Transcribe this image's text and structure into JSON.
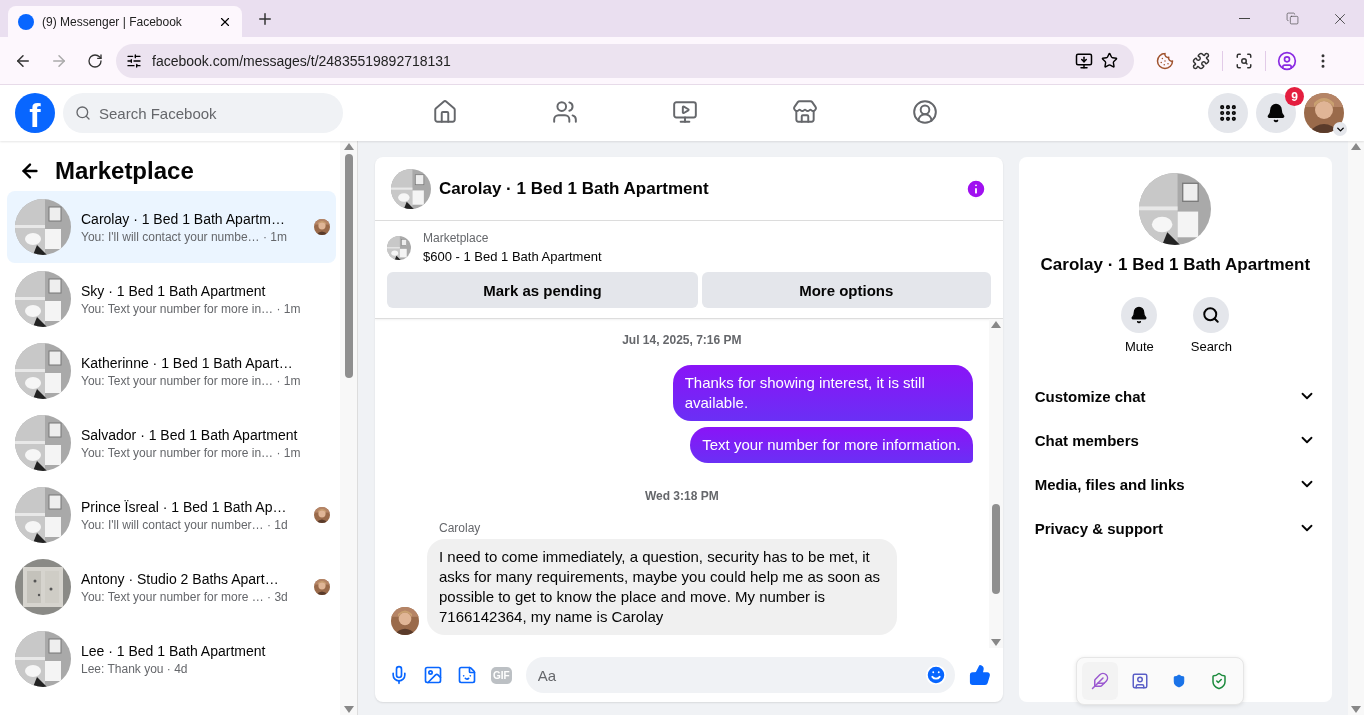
{
  "browser": {
    "tab": {
      "title": "(9) Messenger | Facebook"
    },
    "url": "facebook.com/messages/t/24835519892718131"
  },
  "topbar": {
    "logo": "f",
    "search": {
      "placeholder": "Search Facebook"
    },
    "nav": [
      {
        "kind": "home",
        "selected": false
      },
      {
        "kind": "friends",
        "selected": false
      },
      {
        "kind": "video",
        "selected": false
      },
      {
        "kind": "marketplace",
        "selected": false
      },
      {
        "kind": "groups",
        "selected": false
      }
    ],
    "notifications_badge": "9"
  },
  "sidebar": {
    "title": "Marketplace",
    "conversations": [
      {
        "name": "Carolay · 1 Bed 1 Bath Apartm…",
        "preview": "You: I'll will contact your numbe…",
        "time": "· 1m",
        "selected": true,
        "seen": true
      },
      {
        "name": "Sky · 1 Bed 1 Bath Apartment",
        "preview": "You: Text your number for more in…",
        "time": "· 1m",
        "selected": false,
        "seen": false
      },
      {
        "name": "Katherinne · 1 Bed 1 Bath Apart…",
        "preview": "You: Text your number for more in…",
        "time": "· 1m",
        "selected": false,
        "seen": false
      },
      {
        "name": "Salvador · 1 Bed 1 Bath Apartment",
        "preview": "You: Text your number for more in…",
        "time": "· 1m",
        "selected": false,
        "seen": false
      },
      {
        "name": "Prince Ïsreal · 1 Bed 1 Bath Ap…",
        "preview": "You: I'll will contact your number…",
        "time": "· 1d",
        "selected": false,
        "seen": true
      },
      {
        "name": "Antony · Studio 2 Baths Apart…",
        "preview": "You: Text your number for more …",
        "time": "· 3d",
        "selected": false,
        "seen": true
      },
      {
        "name": "Lee · 1 Bed 1 Bath Apartment",
        "preview": "Lee: Thank you",
        "time": "· 4d",
        "selected": false,
        "seen": false
      }
    ]
  },
  "chat": {
    "title": "Carolay · 1 Bed 1 Bath Apartment",
    "listing": {
      "source": "Marketplace",
      "title": "$600 - 1 Bed 1 Bath Apartment"
    },
    "actions": [
      "Mark as pending",
      "More options"
    ],
    "messages": [
      {
        "kind": "time",
        "text": "Jul 14, 2025, 7:16 PM"
      },
      {
        "kind": "outgoing",
        "text": "Thanks for showing interest, it is still available."
      },
      {
        "kind": "outgoing",
        "text": "Text your number for more information."
      },
      {
        "kind": "time",
        "text": "Wed 3:18 PM"
      },
      {
        "kind": "incoming",
        "sender": "Carolay",
        "text": "I need to come immediately, a question, security has to be met, it asks for many requirements, maybe you could help me as soon as possible to get to know the place and move. My number is 7166142364, my name is Carolay"
      }
    ],
    "composer": {
      "placeholder": "Aa",
      "gif": "GIF"
    }
  },
  "details": {
    "title": "Carolay · 1 Bed 1 Bath Apartment",
    "actions": [
      "Mute",
      "Search"
    ],
    "sections": [
      "Customize chat",
      "Chat members",
      "Media, files and links",
      "Privacy & support"
    ]
  }
}
